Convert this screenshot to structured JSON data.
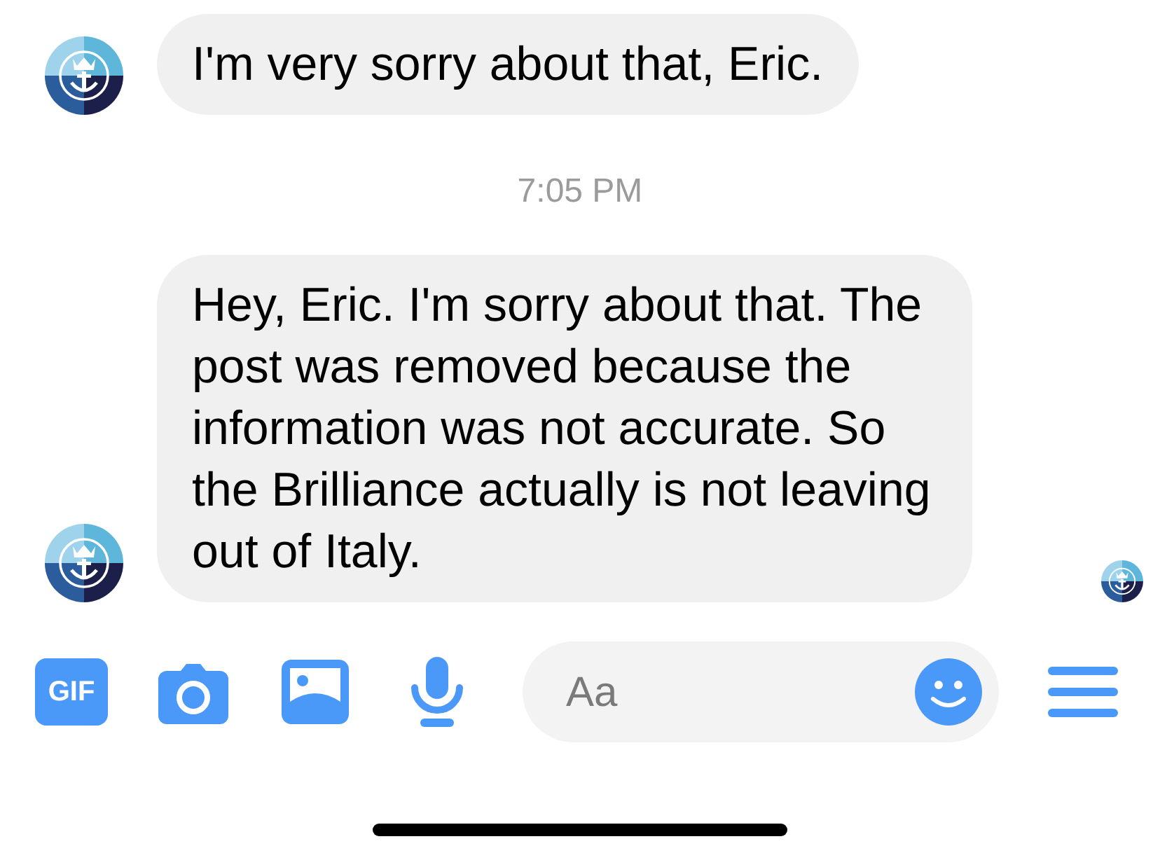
{
  "messages": [
    {
      "text": "I'm very sorry about that, Eric.",
      "show_avatar": true,
      "read_receipt": false
    },
    {
      "kind": "timestamp",
      "text": "7:05 PM"
    },
    {
      "text": "Hey, Eric. I'm sorry about that. The post was removed because the information was not accurate. So the Brilliance actually is not leaving out of Italy.",
      "show_avatar": true,
      "read_receipt": true
    }
  ],
  "composer": {
    "gif_label": "GIF",
    "placeholder": "Aa"
  }
}
